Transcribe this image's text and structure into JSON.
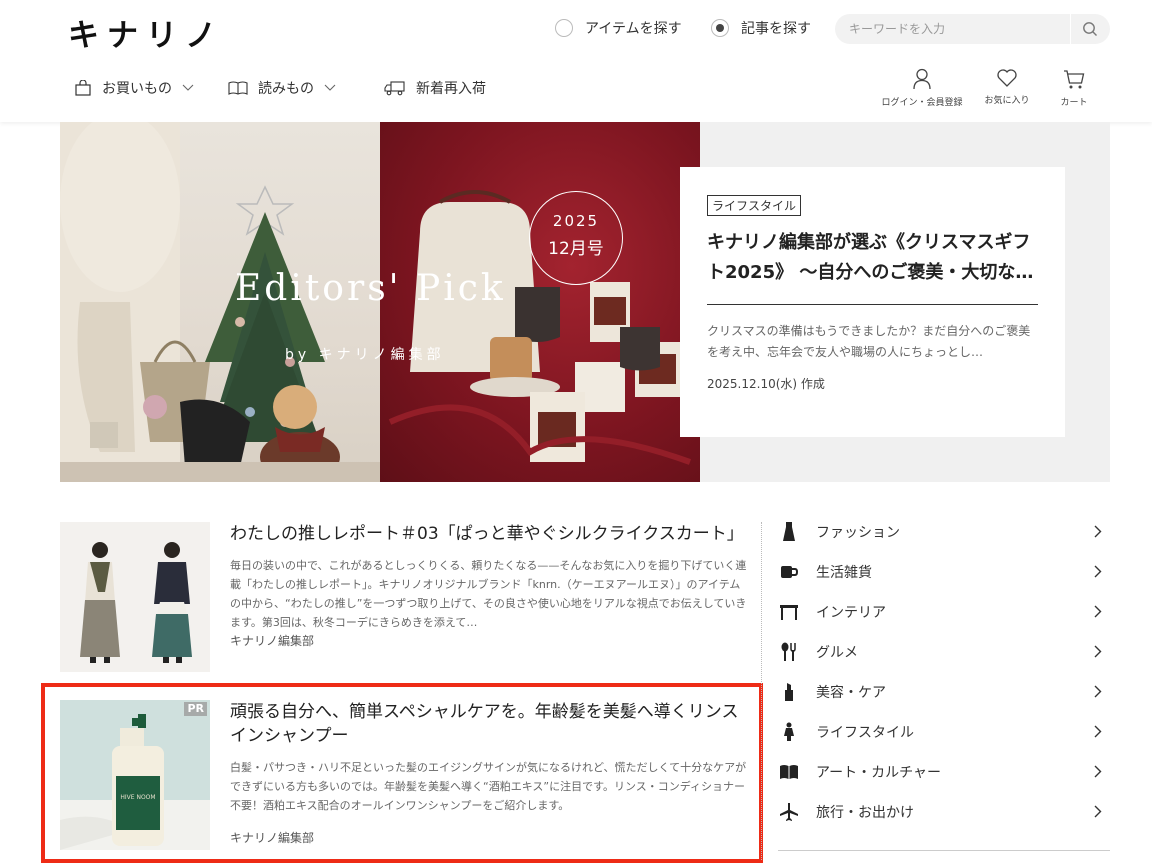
{
  "header": {
    "logo": "キナリノ",
    "search_modes": [
      {
        "label": "アイテムを探す",
        "checked": false
      },
      {
        "label": "記事を探す",
        "checked": true
      }
    ],
    "search_placeholder": "キーワードを入力",
    "nav": [
      {
        "label": "お買いもの",
        "icon": "shopping-bag-icon",
        "dropdown": true
      },
      {
        "label": "読みもの",
        "icon": "book-icon",
        "dropdown": true
      },
      {
        "label": "新着再入荷",
        "icon": "truck-icon",
        "dropdown": false
      }
    ],
    "user_nav": [
      {
        "label": "ログイン・会員登録",
        "icon": "user-icon"
      },
      {
        "label": "お気に入り",
        "icon": "heart-icon"
      },
      {
        "label": "カート",
        "icon": "cart-icon"
      }
    ]
  },
  "hero": {
    "image_title": "Editors' Pick",
    "image_subtitle": "by キナリノ編集部",
    "badge_year": "2025",
    "badge_month": "12月号",
    "tag": "ライフスタイル",
    "title": "キナリノ編集部が選ぶ《クリスマスギフト2025》 〜自分へのご褒美・大切な…",
    "description": "クリスマスの準備はもうできましたか？まだ自分へのご褒美を考え中、忘年会で友人や職場の人にちょっとし…",
    "date": "2025.12.10(水) 作成"
  },
  "articles": [
    {
      "title": "わたしの推しレポート＃03「ぱっと華やぐシルクライクスカート」",
      "description": "毎日の装いの中で、これがあるとしっくりくる、頼りたくなる——そんなお気に入りを掘り下げていく連載「わたしの推しレポート」。キナリノオリジナルブランド「knrn.（ケーエヌアールエヌ）」のアイテムの中から、“わたしの推し”を一つずつ取り上げて、その良さや使い心地をリアルな視点でお伝えしていきます。第3回は、秋冬コーデにきらめきを添えて…",
      "author": "キナリノ編集部"
    },
    {
      "pr_label": "PR",
      "product_label": "HIVE NOOM",
      "title": "頑張る自分へ、簡単スペシャルケアを。年齢髪を美髪へ導くリンスインシャンプー",
      "description": "白髪・パサつき・ハリ不足といった髪のエイジングサインが気になるけれど、慌ただしくて十分なケアができずにいる方も多いのでは。年齢髪を美髪へ導く“酒粕エキス”に注目です。リンス・コンディショナー不要！酒粕エキス配合のオールインワンシャンプーをご紹介します。",
      "author": "キナリノ編集部"
    }
  ],
  "categories": [
    {
      "label": "ファッション",
      "icon": "dress-icon"
    },
    {
      "label": "生活雑貨",
      "icon": "mug-icon"
    },
    {
      "label": "インテリア",
      "icon": "table-icon"
    },
    {
      "label": "グルメ",
      "icon": "cutlery-icon"
    },
    {
      "label": "美容・ケア",
      "icon": "lipstick-icon"
    },
    {
      "label": "ライフスタイル",
      "icon": "person-icon"
    },
    {
      "label": "アート・カルチャー",
      "icon": "open-book-icon"
    },
    {
      "label": "旅行・お出かけ",
      "icon": "airplane-icon"
    }
  ],
  "colors": {
    "highlight": "#ee2b16",
    "text": "#333333",
    "search_bg": "#f2f2f2"
  }
}
